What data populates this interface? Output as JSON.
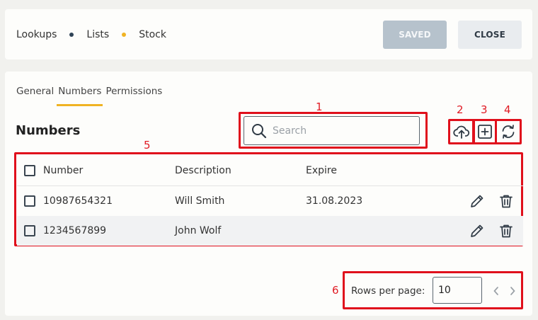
{
  "breadcrumb": {
    "items": [
      "Lookups",
      "Lists",
      "Stock"
    ],
    "separator_colors": [
      "#2f4356",
      "#f0b323"
    ]
  },
  "buttons": {
    "saved": "SAVED",
    "close": "CLOSE"
  },
  "tabs": [
    "General",
    "Numbers",
    "Permissions"
  ],
  "active_tab": "Numbers",
  "section_title": "Numbers",
  "search": {
    "placeholder": "Search",
    "value": ""
  },
  "toolbar_icons": [
    "upload-cloud-icon",
    "add-square-icon",
    "refresh-icon"
  ],
  "annotations": [
    "1",
    "2",
    "3",
    "4",
    "5",
    "6"
  ],
  "table": {
    "headers": [
      "Number",
      "Description",
      "Expire"
    ],
    "rows": [
      {
        "number": "10987654321",
        "description": "Will Smith",
        "expire": "31.08.2023"
      },
      {
        "number": "1234567899",
        "description": "John Wolf",
        "expire": ""
      }
    ],
    "row_actions": [
      "pencil-icon",
      "trash-icon"
    ]
  },
  "pagination": {
    "rows_per_page_label": "Rows per page:",
    "rows_per_page_value": "10"
  },
  "colors": {
    "accent": "#f0b323",
    "annotation_red": "#e0101c",
    "saved_button": "#b6c2cc"
  }
}
